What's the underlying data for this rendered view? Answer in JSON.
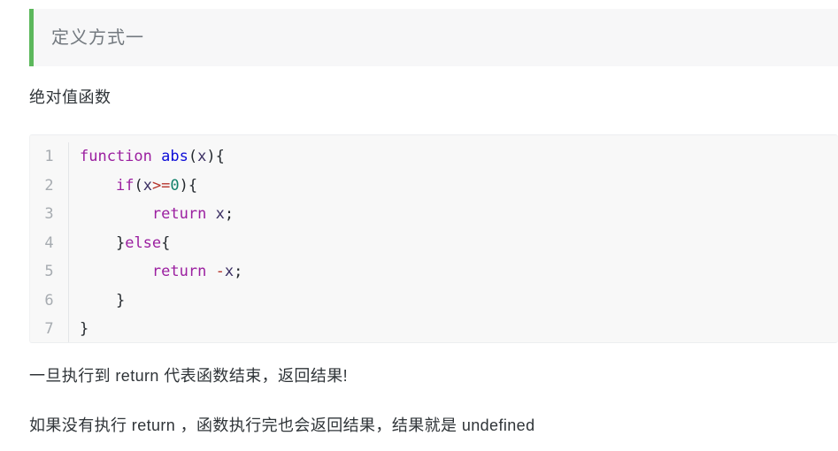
{
  "callout": {
    "title": "定义方式一",
    "accent_color": "#5cb85c",
    "background_color": "#f7f7f8",
    "title_color": "#73797f"
  },
  "subheading": "绝对值函数",
  "code_block": {
    "language": "javascript",
    "background_color": "#f8f8f8",
    "gutter_color": "#a7acb1",
    "line_numbers": [
      "1",
      "2",
      "3",
      "4",
      "5",
      "6",
      "7"
    ],
    "lines": [
      {
        "number": "1",
        "plain": "function abs(x){",
        "tokens": [
          {
            "text": "function",
            "type": "keyword"
          },
          {
            "text": " ",
            "type": "plain"
          },
          {
            "text": "abs",
            "type": "function"
          },
          {
            "text": "(",
            "type": "punctuation"
          },
          {
            "text": "x",
            "type": "variable"
          },
          {
            "text": ")",
            "type": "punctuation"
          },
          {
            "text": "{",
            "type": "punctuation"
          }
        ]
      },
      {
        "number": "2",
        "plain": "    if(x>=0){",
        "tokens": [
          {
            "text": "    ",
            "type": "plain"
          },
          {
            "text": "if",
            "type": "keyword"
          },
          {
            "text": "(",
            "type": "punctuation"
          },
          {
            "text": "x",
            "type": "variable"
          },
          {
            "text": ">=",
            "type": "operator"
          },
          {
            "text": "0",
            "type": "number"
          },
          {
            "text": ")",
            "type": "punctuation"
          },
          {
            "text": "{",
            "type": "punctuation"
          }
        ]
      },
      {
        "number": "3",
        "plain": "        return x;",
        "tokens": [
          {
            "text": "        ",
            "type": "plain"
          },
          {
            "text": "return",
            "type": "keyword"
          },
          {
            "text": " ",
            "type": "plain"
          },
          {
            "text": "x",
            "type": "variable"
          },
          {
            "text": ";",
            "type": "punctuation"
          }
        ]
      },
      {
        "number": "4",
        "plain": "    }else{",
        "tokens": [
          {
            "text": "    ",
            "type": "plain"
          },
          {
            "text": "}",
            "type": "punctuation"
          },
          {
            "text": "else",
            "type": "keyword"
          },
          {
            "text": "{",
            "type": "punctuation"
          }
        ]
      },
      {
        "number": "5",
        "plain": "        return -x;",
        "tokens": [
          {
            "text": "        ",
            "type": "plain"
          },
          {
            "text": "return",
            "type": "keyword"
          },
          {
            "text": " ",
            "type": "plain"
          },
          {
            "text": "-",
            "type": "operator"
          },
          {
            "text": "x",
            "type": "variable"
          },
          {
            "text": ";",
            "type": "punctuation"
          }
        ]
      },
      {
        "number": "6",
        "plain": "    }",
        "tokens": [
          {
            "text": "    ",
            "type": "plain"
          },
          {
            "text": "}",
            "type": "punctuation"
          }
        ]
      },
      {
        "number": "7",
        "plain": "}",
        "tokens": [
          {
            "text": "}",
            "type": "punctuation"
          }
        ]
      }
    ]
  },
  "paragraphs": [
    "一旦执行到 return 代表函数结束，返回结果!",
    "如果没有执行 return ，函数执行完也会返回结果，结果就是 undefined"
  ]
}
